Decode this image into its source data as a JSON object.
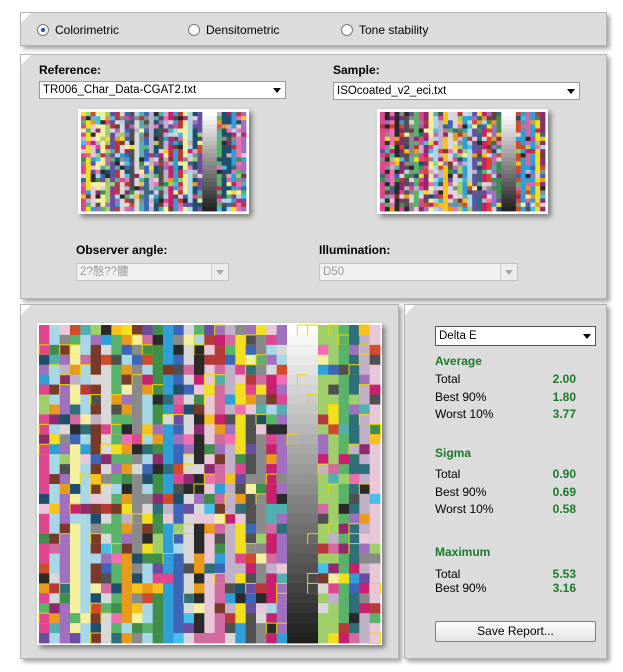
{
  "mode_tabs": {
    "options": [
      "Colorimetric",
      "Densitometric",
      "Tone stability"
    ],
    "selected": "Colorimetric"
  },
  "files": {
    "reference_label": "Reference:",
    "reference_value": "TR006_Char_Data-CGAT2.txt",
    "sample_label": "Sample:",
    "sample_value": "ISOcoated_v2_eci.txt",
    "observer_label": "Observer angle:",
    "observer_value": "2?慤??髏",
    "illumination_label": "Illumination:",
    "illumination_value": "D50"
  },
  "stats": {
    "metric_select": "Delta E",
    "average": {
      "title": "Average",
      "total_label": "Total",
      "total": "2.00",
      "best_label": "Best 90%",
      "best": "1.80",
      "worst_label": "Worst 10%",
      "worst": "3.77"
    },
    "sigma": {
      "title": "Sigma",
      "total_label": "Total",
      "total": "0.90",
      "best_label": "Best 90%",
      "best": "0.69",
      "worst_label": "Worst 10%",
      "worst": "0.58"
    },
    "maximum": {
      "title": "Maximum",
      "total_label": "Total",
      "total": "5.53",
      "best_label": "Best 90%",
      "best": "3.16"
    },
    "save_label": "Save Report..."
  },
  "colors": {
    "panel_bg": "#dcdcdc",
    "stat_green": "#1a7a2a",
    "highlight": "#e8d800"
  }
}
